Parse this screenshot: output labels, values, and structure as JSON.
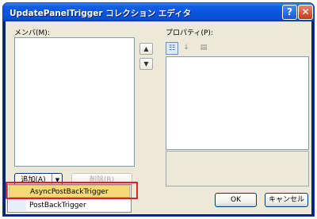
{
  "window": {
    "title": "UpdatePanelTrigger コレクション エディタ",
    "help_button": "?",
    "close_button": "✕"
  },
  "members": {
    "label": "メンバ(M):",
    "move_up_icon": "arrow-up-icon",
    "move_down_icon": "arrow-down-icon"
  },
  "properties": {
    "label": "プロパティ(P):",
    "toolbar": [
      "categorized-icon",
      "alphabetical-icon",
      "property-pages-icon"
    ]
  },
  "buttons": {
    "add": "追加(A)",
    "remove": "削除(R)",
    "ok": "OK",
    "cancel": "キャンセル"
  },
  "add_menu": {
    "items": [
      {
        "label": "AsyncPostBackTrigger",
        "highlighted": true
      },
      {
        "label": "PostBackTrigger",
        "highlighted": false
      }
    ]
  },
  "colors": {
    "title_bar": "#0a55df",
    "dialog_face": "#ece9d8",
    "highlight_frame": "#d9212c",
    "menu_highlight": "#f5d87a"
  }
}
